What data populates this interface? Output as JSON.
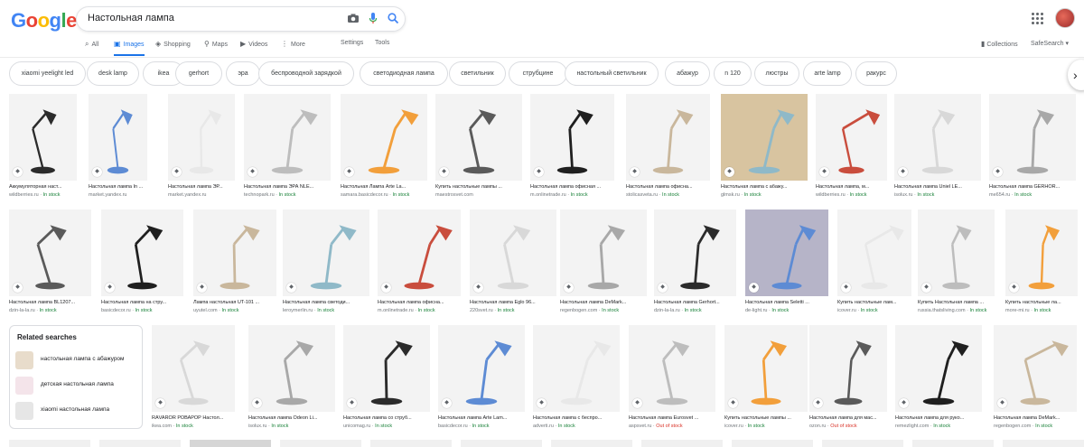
{
  "header": {
    "logo": [
      "G",
      "o",
      "o",
      "g",
      "l",
      "e"
    ],
    "search_query": "Настольная лампа",
    "camera_icon": "camera-icon",
    "mic_icon": "microphone-icon",
    "search_icon": "search-icon"
  },
  "tabs": [
    {
      "label": "All",
      "icon": "search-icon"
    },
    {
      "label": "Images",
      "icon": "image-icon",
      "active": true
    },
    {
      "label": "Shopping",
      "icon": "tag-icon"
    },
    {
      "label": "Maps",
      "icon": "pin-icon"
    },
    {
      "label": "Videos",
      "icon": "play-icon"
    },
    {
      "label": "More",
      "icon": "more-vert-icon"
    },
    {
      "label": "Settings"
    },
    {
      "label": "Tools"
    }
  ],
  "right_tools": {
    "collections": "Collections",
    "safesearch": "SafeSearch ▾"
  },
  "chips": [
    "xiaomi yeelight led",
    "desk lamp",
    "ikea",
    "gerhort",
    "эра",
    "беспроводной зарядкой",
    "светодиодная лампа",
    "светильник",
    "струбцине",
    "настольный светильник",
    "абажур",
    "n 120",
    "люстры",
    "arte lamp",
    "ракурс"
  ],
  "rows": [
    [
      {
        "title": "Аккумуляторная наст...",
        "source": "wildberries.ru",
        "stock": "In stock"
      },
      {
        "title": "Настольная лампа In ...",
        "source": "market.yandex.ru",
        "stock": ""
      },
      {
        "title": "Настольная лампа ЭР...",
        "source": "market.yandex.ru",
        "stock": ""
      },
      {
        "title": "Настольная лампа ЭРА NLE...",
        "source": "technopark.ru",
        "stock": "In stock"
      },
      {
        "title": "Настольная Лампа Arte La...",
        "source": "samara.basicdecor.ru",
        "stock": "In stock"
      },
      {
        "title": "Купить настольные лампы ...",
        "source": "maestrosvet.com",
        "stock": ""
      },
      {
        "title": "Настольная лампа офисная ...",
        "source": "m.onlinetrade.ru",
        "stock": "In stock"
      },
      {
        "title": "Настольная лампа офисна...",
        "source": "stolicasveta.ru",
        "stock": "In stock"
      },
      {
        "title": "Настольная лампа с абажу...",
        "source": "glmsk.ru",
        "stock": "In stock"
      },
      {
        "title": "Настольная лампа, м...",
        "source": "wildberries.ru",
        "stock": "In stock"
      },
      {
        "title": "Настольная лампа Uniel LE...",
        "source": "isolux.ru",
        "stock": "In stock"
      },
      {
        "title": "Настольная лампа GERHOR...",
        "source": "me654.ru",
        "stock": "In stock"
      }
    ],
    [
      {
        "title": "Настольная лампа BL1207...",
        "source": "dzin-la-la.ru",
        "stock": "In stock"
      },
      {
        "title": "Настольная лампа на стру...",
        "source": "basicdecor.ru",
        "stock": "In stock"
      },
      {
        "title": "Лампа настольная UT-101 ...",
        "source": "uyutel.com",
        "stock": "In stock"
      },
      {
        "title": "Настольная лампа светоди...",
        "source": "leroymerlin.ru",
        "stock": "In stock"
      },
      {
        "title": "Настольная лампа офисна...",
        "source": "m.onlinetrade.ru",
        "stock": "In stock"
      },
      {
        "title": "Настольная лампа Eglo 96...",
        "source": "220svet.ru",
        "stock": "In stock"
      },
      {
        "title": "Настольная лампа DeMark...",
        "source": "regenbogen.com",
        "stock": "In stock"
      },
      {
        "title": "Настольная лампа Gerhort...",
        "source": "dzin-la-la.ru",
        "stock": "In stock"
      },
      {
        "title": "Настольная лампа Seletti ...",
        "source": "de-light.ru",
        "stock": "In stock"
      },
      {
        "title": "Купить настольные лам...",
        "source": "icover.ru",
        "stock": "In stock"
      },
      {
        "title": "Купить Настольная лампа ...",
        "source": "russia.thatsliving.com",
        "stock": "In stock"
      },
      {
        "title": "Купить настольные ла...",
        "source": "more-mi.ru",
        "stock": "In stock"
      }
    ],
    [
      {
        "title": "RÅVAROR РОВАРОР Настол...",
        "source": "ikea.com",
        "stock": "In stock"
      },
      {
        "title": "Настольная лампа Odeon Li...",
        "source": "isolux.ru",
        "stock": "In stock"
      },
      {
        "title": "Настольная лампа со струб...",
        "source": "unicomag.ru",
        "stock": "In stock"
      },
      {
        "title": "Настольная лампа Arte Lam...",
        "source": "basicdecor.ru",
        "stock": "In stock"
      },
      {
        "title": "Настольная лампа с беспро...",
        "source": "adverti.ru",
        "stock": "In stock"
      },
      {
        "title": "Настольная лампа Eurosvet ...",
        "source": "aspsvet.ru",
        "stock": "Out of stock"
      },
      {
        "title": "Купить настольные лампы ...",
        "source": "icover.ru",
        "stock": "In stock"
      },
      {
        "title": "Настольная лампа для мас...",
        "source": "ozon.ru",
        "stock": "Out of stock"
      },
      {
        "title": "Настольная лампа для руко...",
        "source": "remezlight.com",
        "stock": "In stock"
      },
      {
        "title": "Настольная лампа DeMark...",
        "source": "regenbogen.com",
        "stock": "In stock"
      }
    ]
  ],
  "related": {
    "title": "Related searches",
    "items": [
      "настольная лампа с абажуром",
      "детская настольная лампа",
      "xiaomi настольная лампа"
    ]
  },
  "colors": {
    "accent": "#1a73e8",
    "in_stock": "#188038",
    "out_of_stock": "#d93025"
  }
}
